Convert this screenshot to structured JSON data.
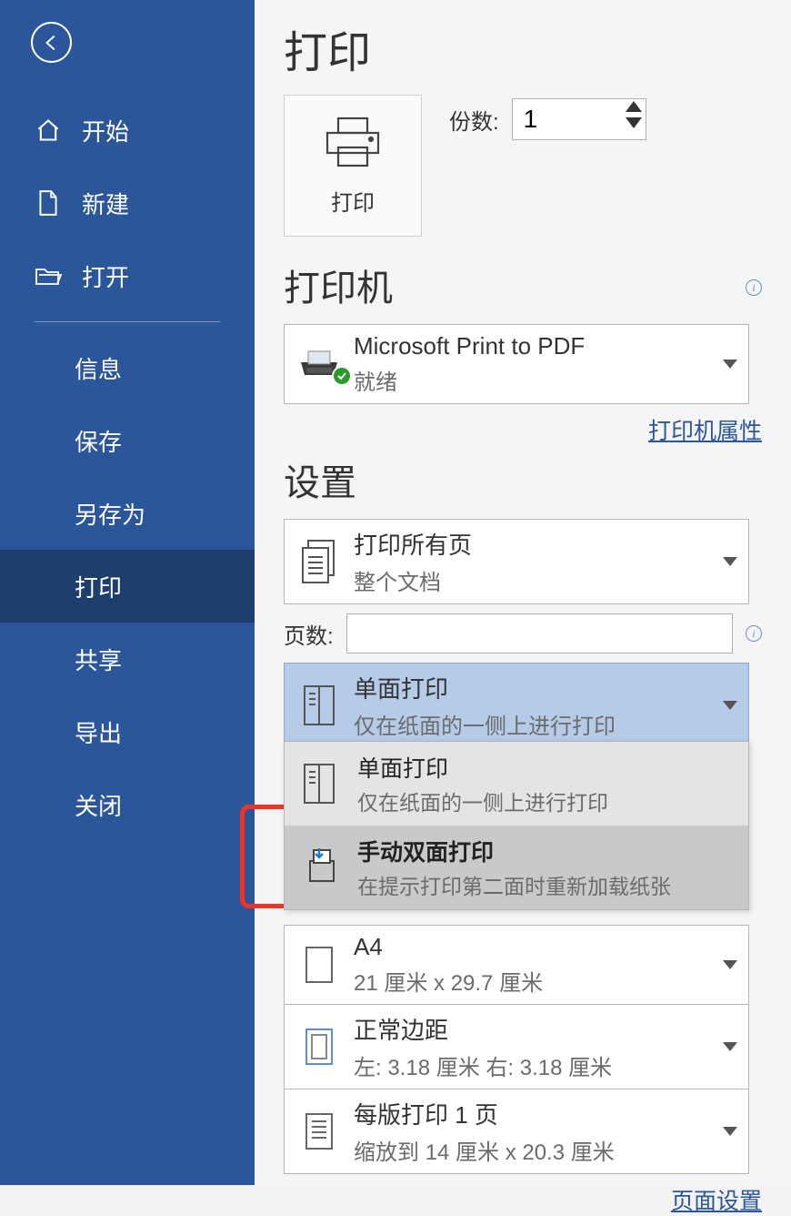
{
  "sidebar": {
    "items": [
      {
        "label": "开始"
      },
      {
        "label": "新建"
      },
      {
        "label": "打开"
      },
      {
        "label": "信息"
      },
      {
        "label": "保存"
      },
      {
        "label": "另存为"
      },
      {
        "label": "打印"
      },
      {
        "label": "共享"
      },
      {
        "label": "导出"
      },
      {
        "label": "关闭"
      }
    ]
  },
  "title": "打印",
  "print_button_label": "打印",
  "copies": {
    "label": "份数:",
    "value": "1"
  },
  "printer_section": {
    "heading": "打印机",
    "selected": {
      "name": "Microsoft Print to PDF",
      "status": "就绪"
    },
    "properties_link": "打印机属性"
  },
  "settings_section": {
    "heading": "设置",
    "print_scope": {
      "title": "打印所有页",
      "subtitle": "整个文档"
    },
    "pages_label": "页数:",
    "sides": {
      "selected": {
        "title": "单面打印",
        "subtitle": "仅在纸面的一侧上进行打印"
      },
      "options": [
        {
          "title": "单面打印",
          "subtitle": "仅在纸面的一侧上进行打印"
        },
        {
          "title": "手动双面打印",
          "subtitle": "在提示打印第二面时重新加载纸张"
        }
      ]
    },
    "paper": {
      "title": "A4",
      "subtitle": "21 厘米 x 29.7 厘米"
    },
    "margins": {
      "title": "正常边距",
      "subtitle": "左:  3.18 厘米    右:  3.18 厘米"
    },
    "per_sheet": {
      "title": "每版打印 1 页",
      "subtitle": "缩放到 14 厘米 x 20.3 厘米"
    },
    "page_setup_link": "页面设置"
  }
}
